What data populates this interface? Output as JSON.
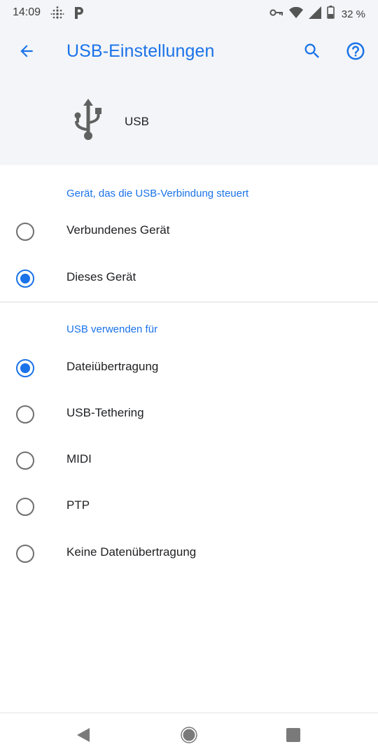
{
  "status_bar": {
    "time": "14:09",
    "battery_percent": "32 %"
  },
  "header": {
    "title": "USB-Einstellungen",
    "usb_label": "USB"
  },
  "colors": {
    "accent": "#1a73e8",
    "header_bg": "#f4f5f8",
    "text": "#202124",
    "radio_off": "#6f6f6f"
  },
  "sections": [
    {
      "title": "Gerät, das die USB-Verbindung steuert",
      "options": [
        {
          "label": "Verbundenes Gerät",
          "selected": false
        },
        {
          "label": "Dieses Gerät",
          "selected": true
        }
      ]
    },
    {
      "title": "USB verwenden für",
      "options": [
        {
          "label": "Dateiübertragung",
          "selected": true
        },
        {
          "label": "USB-Tethering",
          "selected": false
        },
        {
          "label": "MIDI",
          "selected": false
        },
        {
          "label": "PTP",
          "selected": false
        },
        {
          "label": "Keine Datenübertragung",
          "selected": false
        }
      ]
    }
  ],
  "icons": {
    "back": "arrow-back-icon",
    "search": "search-icon",
    "help": "help-icon",
    "usb": "usb-icon"
  }
}
